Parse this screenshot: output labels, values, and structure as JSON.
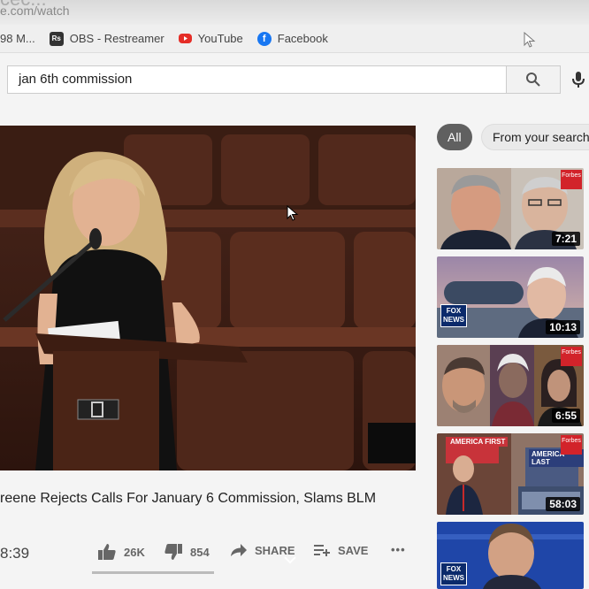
{
  "browser": {
    "tab_title_fragment": "cec...",
    "url_fragment": "e.com/watch"
  },
  "bookmarks": [
    {
      "icon": "globe-icon",
      "label": "98 M..."
    },
    {
      "icon": "obs-icon",
      "badge": "Rs",
      "label": "OBS - Restreamer"
    },
    {
      "icon": "youtube-icon",
      "label": "YouTube"
    },
    {
      "icon": "facebook-icon",
      "badge": "f",
      "label": "Facebook"
    }
  ],
  "search": {
    "value": "jan 6th commission"
  },
  "video": {
    "title": "reene Rejects Calls For January 6 Commission, Slams BLM",
    "elapsed": "8:39",
    "likes": "26K",
    "dislikes": "854",
    "share_label": "SHARE",
    "save_label": "SAVE",
    "more_label": "•••"
  },
  "chips": [
    {
      "label": "All",
      "selected": true
    },
    {
      "label": "From your search",
      "selected": false
    }
  ],
  "recommendations": [
    {
      "duration": "7:21",
      "badge": "Forbes",
      "colors": [
        "#b85e4a",
        "#6b4034",
        "#1a2333"
      ]
    },
    {
      "duration": "10:13",
      "network": "FOX NEWS",
      "colors": [
        "#5c7296",
        "#1d2a44",
        "#d8a88a"
      ]
    },
    {
      "duration": "6:55",
      "badge": "Forbes",
      "colors": [
        "#8b6d5e",
        "#3a2b40",
        "#c7a38b"
      ]
    },
    {
      "duration": "58:03",
      "badge": "Forbes",
      "sign_left": "AMERICA FIRST",
      "sign_right": "AMERICA LAST",
      "colors": [
        "#7b4a3a",
        "#2b3656",
        "#9aa7c2"
      ]
    },
    {
      "network": "FOX NEWS",
      "colors": [
        "#1b3f9a",
        "#2c2c45",
        "#cc9a7f"
      ]
    }
  ],
  "colors": {
    "accent_red": "#e52d27",
    "facebook_blue": "#1877f2",
    "chip_selected": "#606060"
  }
}
